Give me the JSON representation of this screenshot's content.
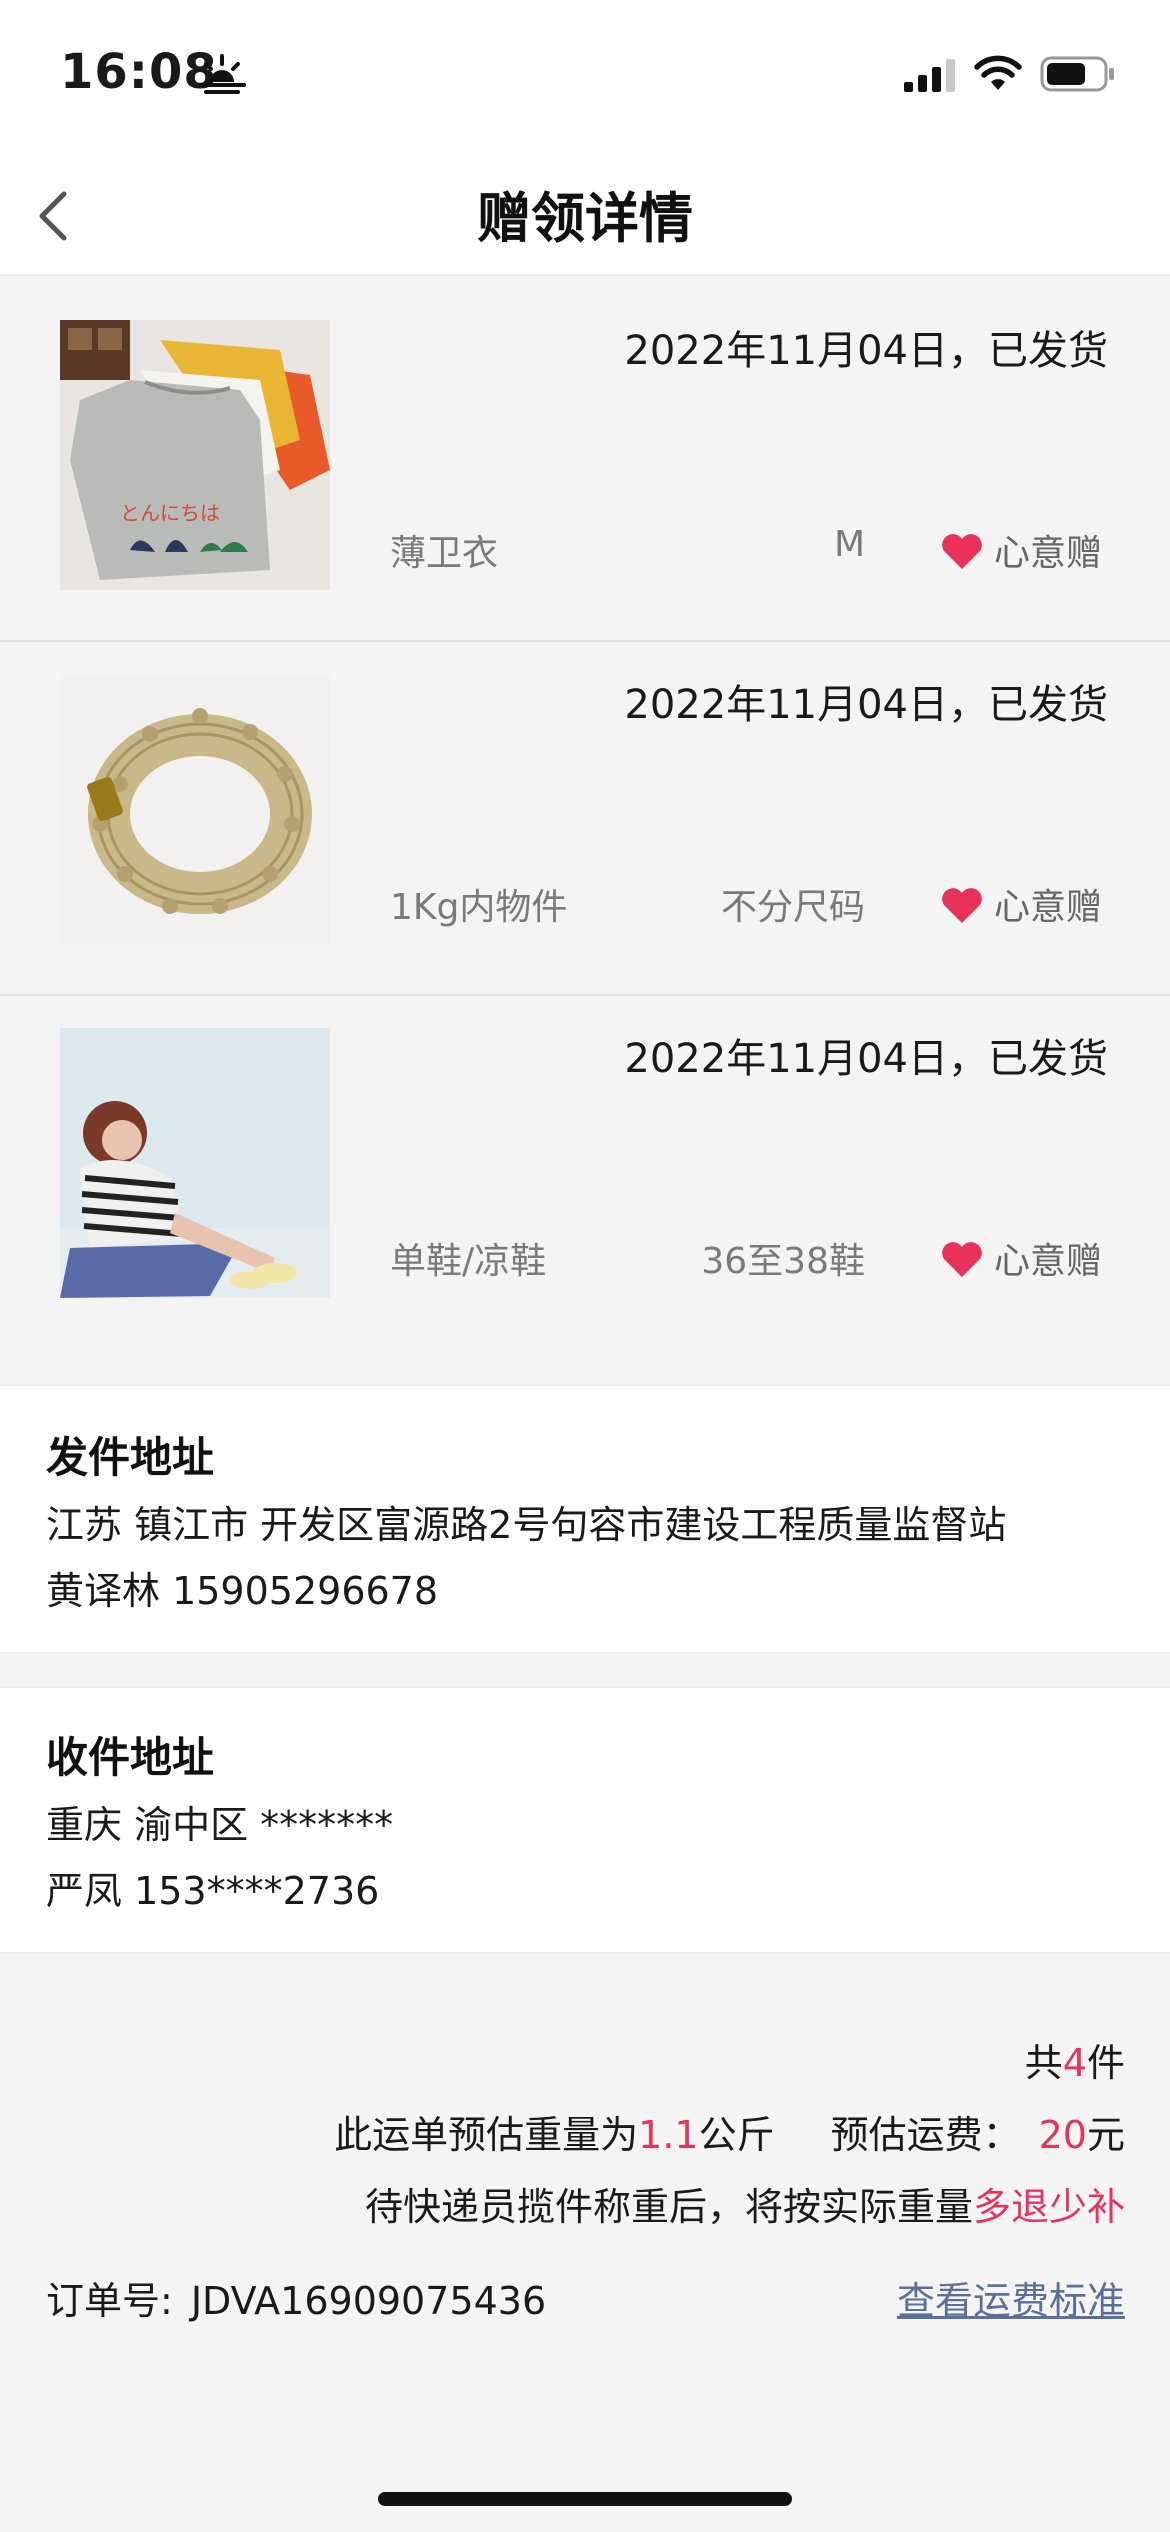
{
  "status": {
    "time": "16:08"
  },
  "nav": {
    "title": "赠领详情"
  },
  "items": [
    {
      "date": "2022年11月04日，已发货",
      "name": "薄卫衣",
      "size": "M",
      "gift": "心意赠"
    },
    {
      "date": "2022年11月04日，已发货",
      "name": "1Kg内物件",
      "size": "不分尺码",
      "gift": "心意赠"
    },
    {
      "date": "2022年11月04日，已发货",
      "name": "单鞋/凉鞋",
      "size": "36至38鞋",
      "gift": "心意赠"
    }
  ],
  "sender": {
    "title": "发件地址",
    "address": "江苏 镇江市 开发区富源路2号句容市建设工程质量监督站",
    "contact": "黄译林 15905296678"
  },
  "receiver": {
    "title": "收件地址",
    "address": "重庆 渝中区 *******",
    "contact": "严凤 153****2736"
  },
  "summary": {
    "count_prefix": "共",
    "count": "4",
    "count_suffix": "件",
    "weight_prefix": "此运单预估重量为",
    "weight": "1.1",
    "weight_suffix": "公斤",
    "fee_prefix": "预估运费：",
    "fee": "20",
    "fee_suffix": "元",
    "note_prefix": "待快递员揽件称重后，将按实际重量",
    "note_highlight": "多退少补",
    "order_label": "订单号:",
    "order_number": "JDVA16909075436",
    "fee_link": "查看运费标准"
  },
  "colors": {
    "accent": "#e8325a",
    "link": "#5a6f9a",
    "heart": "#e8325a"
  }
}
